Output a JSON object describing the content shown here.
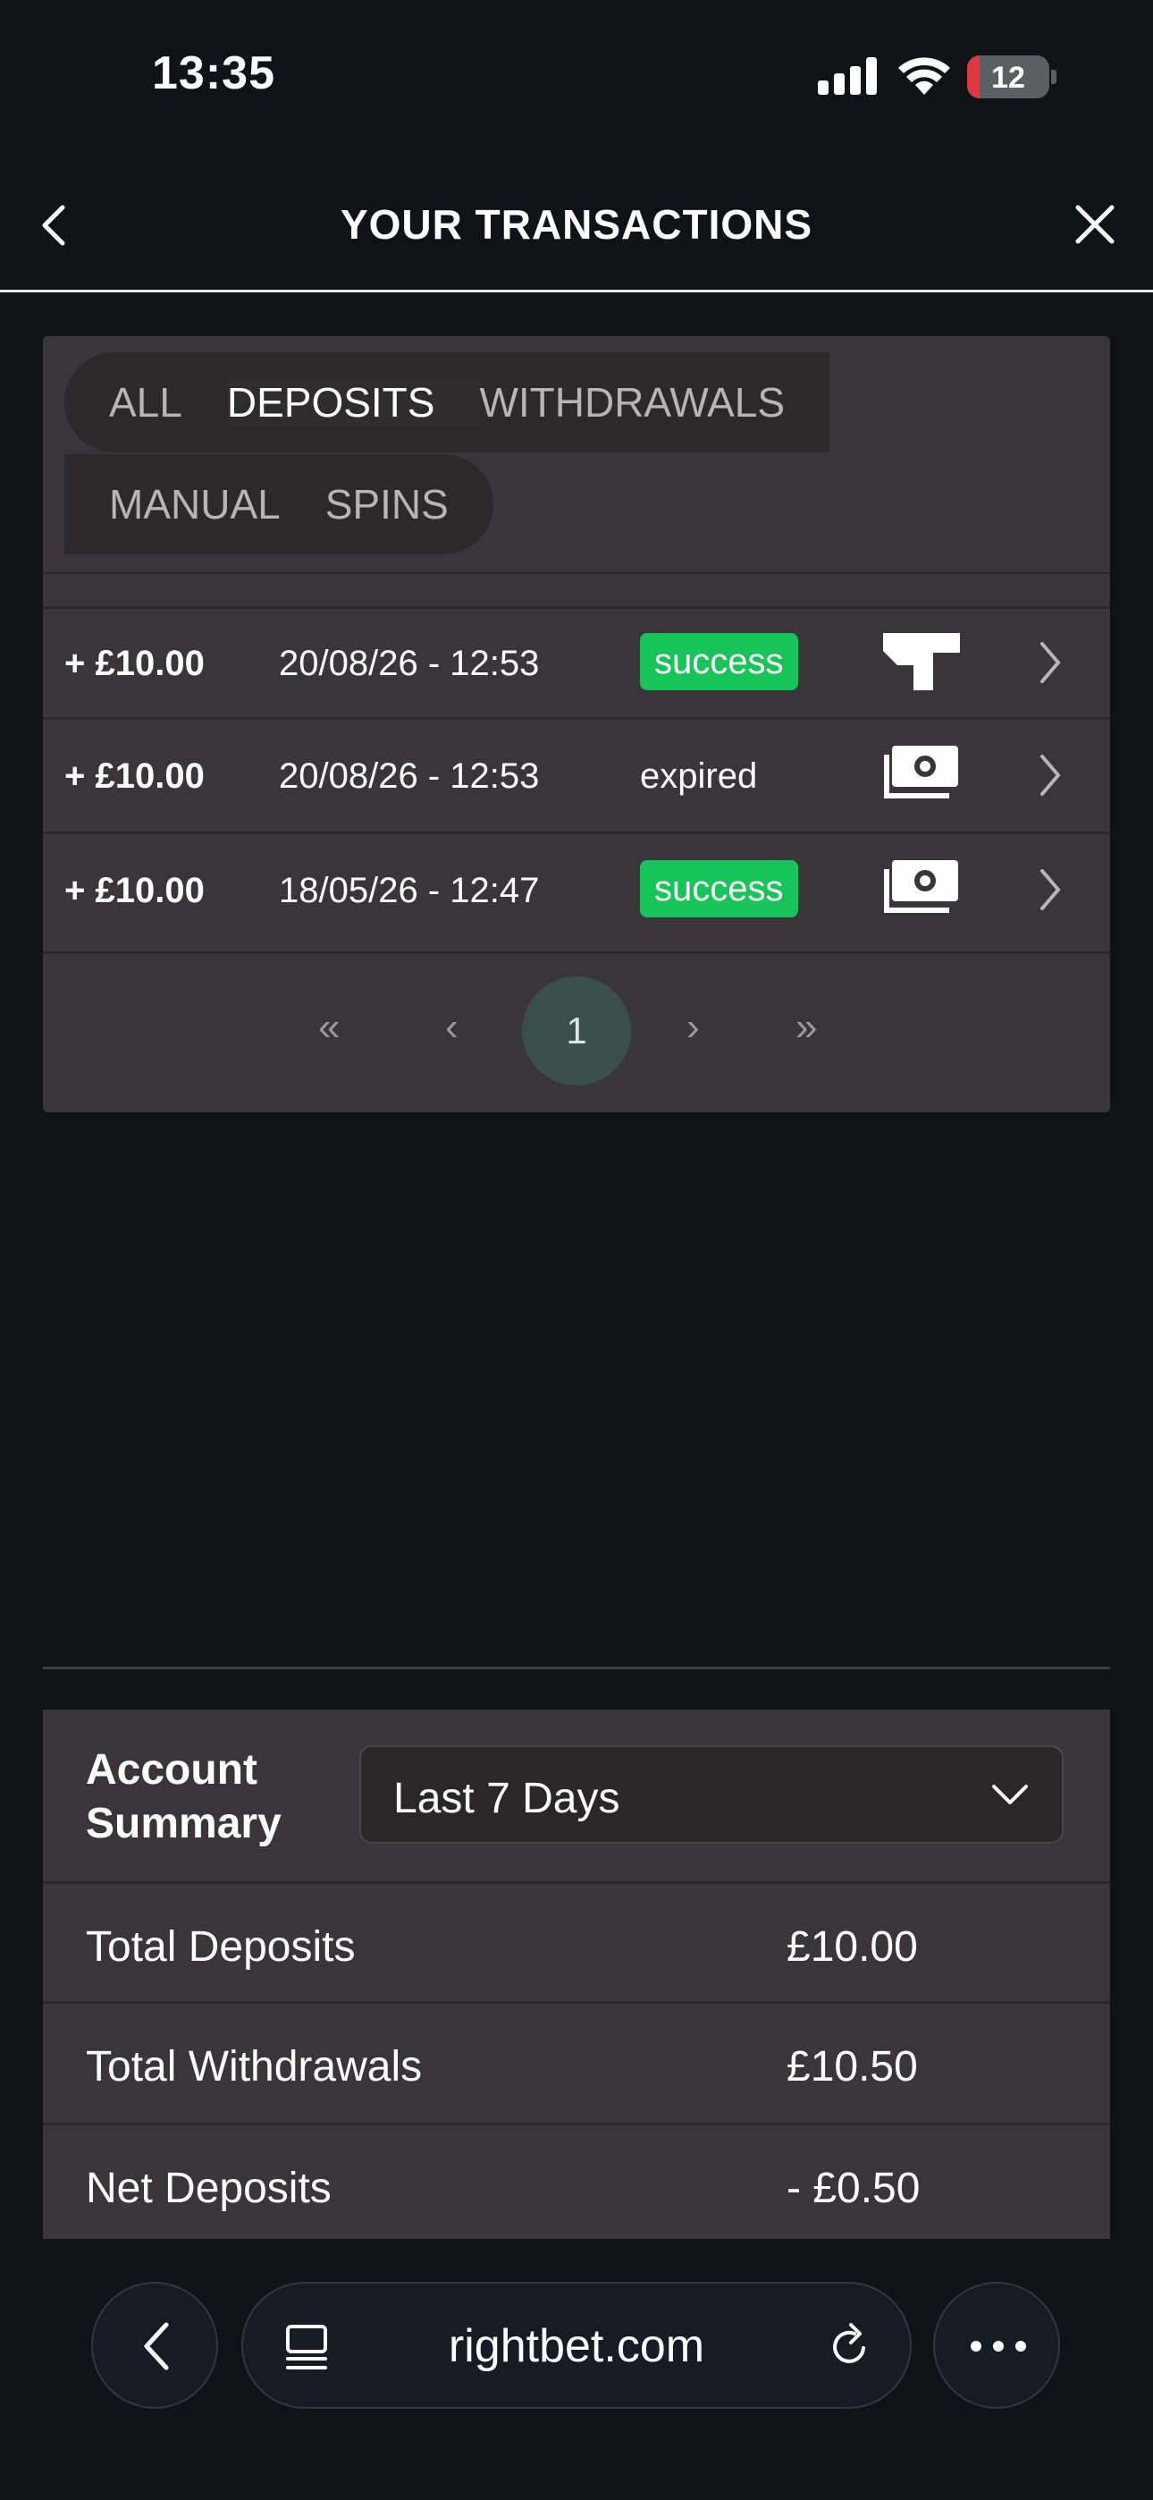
{
  "status_bar": {
    "time": "13:35",
    "battery": "12"
  },
  "header": {
    "title": "YOUR TRANSACTIONS"
  },
  "tabs": [
    {
      "label": "ALL",
      "active": false
    },
    {
      "label": "DEPOSITS",
      "active": true
    },
    {
      "label": "WITHDRAWALS",
      "active": false
    },
    {
      "label": "MANUAL",
      "active": false
    },
    {
      "label": "SPINS",
      "active": false
    }
  ],
  "transactions": [
    {
      "amount": "+ £10.00",
      "date": "20/08/26 - 12:53",
      "status": "success",
      "method_icon": "trustly-logo-icon"
    },
    {
      "amount": "+ £10.00",
      "date": "20/08/26 - 12:53",
      "status": "expired",
      "method_icon": "cash-icon"
    },
    {
      "amount": "+ £10.00",
      "date": "18/05/26 - 12:47",
      "status": "success",
      "method_icon": "cash-icon"
    }
  ],
  "pagination": {
    "first": "«",
    "prev": "‹",
    "current": "1",
    "next": "›",
    "last": "»"
  },
  "summary": {
    "title": "Account Summary",
    "period": "Last 7 Days",
    "rows": [
      {
        "label": "Total Deposits",
        "value": "£10.00"
      },
      {
        "label": "Total Withdrawals",
        "value": "£10.50"
      },
      {
        "label": "Net Deposits",
        "value": "- £0.50"
      }
    ]
  },
  "browser": {
    "url": "rightbet.com"
  },
  "colors": {
    "success": "#17c45a",
    "page_bg": "#0e1318",
    "panel_bg": "#3a3538",
    "pager_active": "#3a4f4b"
  }
}
